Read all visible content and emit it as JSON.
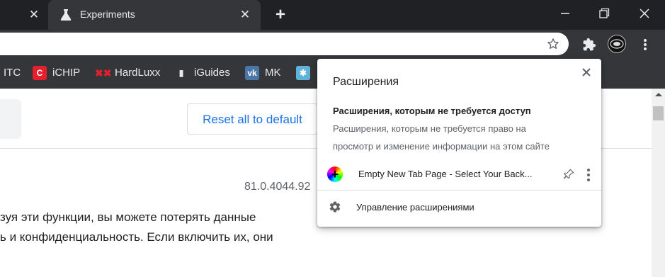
{
  "tabs": {
    "active_title": "Experiments"
  },
  "bookmarks": [
    {
      "label": "ITC",
      "icon": "itc-icon"
    },
    {
      "label": "iCHIP",
      "icon": "ichip-icon"
    },
    {
      "label": "HardLuxx",
      "icon": "hardluxx-icon"
    },
    {
      "label": "iGuides",
      "icon": "iguides-icon"
    },
    {
      "label": "MK",
      "icon": "vk-icon"
    },
    {
      "label": "",
      "icon": "snowflake-icon"
    }
  ],
  "page": {
    "reset_label": "Reset all to default",
    "version": "81.0.4044.92",
    "warning_line1": "зуя эти функции, вы можете потерять данные",
    "warning_line2": "ь и конфиденциальность. Если включить их, они"
  },
  "extensions_popup": {
    "title": "Расширения",
    "section_title": "Расширения, которым не требуется доступ",
    "section_desc_line1": "Расширения, которым не требуется право на",
    "section_desc_line2": "просмотр и изменение информации на этом сайте",
    "extension_name": "Empty New Tab Page - Select Your Back...",
    "manage_label": "Управление расширениями"
  },
  "colors": {
    "tabbar_bg": "#202124",
    "toolbar_bg": "#35363a",
    "link_blue": "#1a73e8"
  }
}
